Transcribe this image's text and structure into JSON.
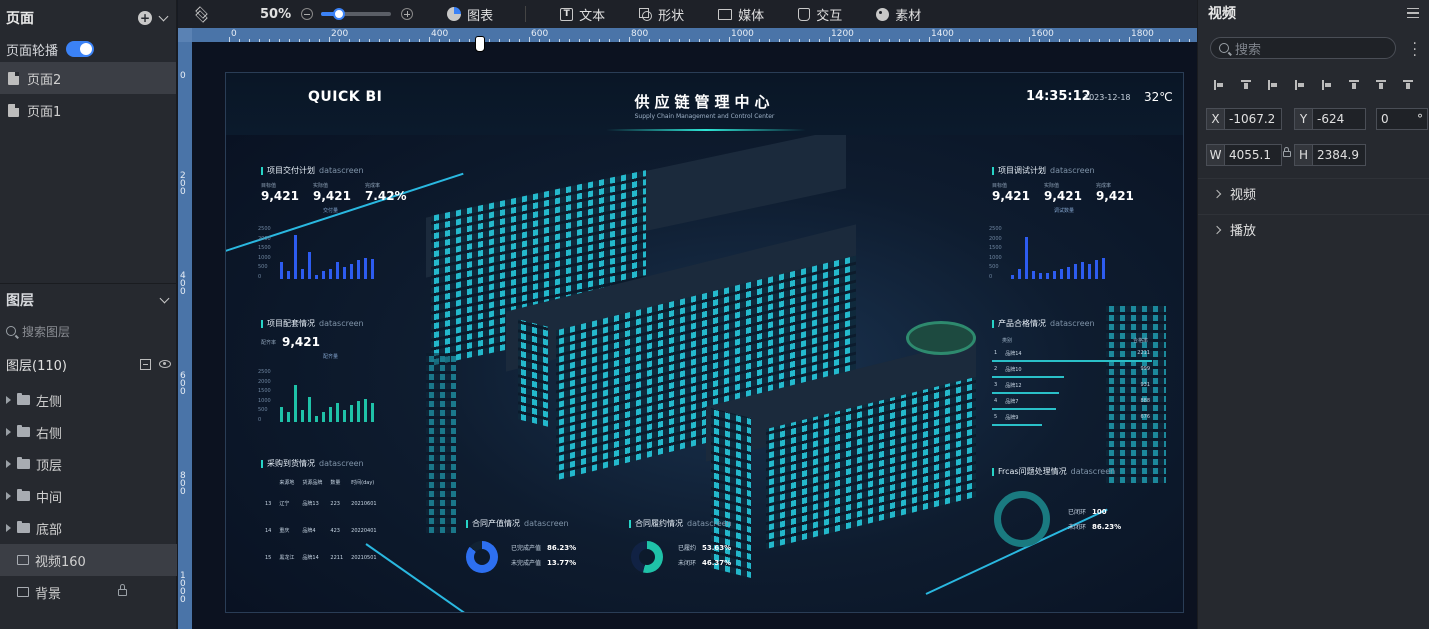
{
  "left_panel": {
    "pages_title": "页面",
    "carousel_label": "页面轮播",
    "pages": [
      {
        "label": "页面2",
        "selected": true
      },
      {
        "label": "页面1",
        "selected": false
      }
    ],
    "layers_title": "图层",
    "search_placeholder": "搜索图层",
    "layer_count_label": "图层(110)",
    "layers": [
      {
        "label": "左侧",
        "type": "folder"
      },
      {
        "label": "右侧",
        "type": "folder"
      },
      {
        "label": "顶层",
        "type": "folder"
      },
      {
        "label": "中间",
        "type": "folder"
      },
      {
        "label": "底部",
        "type": "folder"
      },
      {
        "label": "视频160",
        "type": "image",
        "selected": true
      },
      {
        "label": "背景",
        "type": "image",
        "locked": true
      }
    ]
  },
  "toolbar": {
    "zoom": "50%",
    "zoom_fraction": 0.25,
    "items": [
      {
        "label": "图表",
        "icon": "chart-icon"
      },
      {
        "label": "文本",
        "icon": "text-icon"
      },
      {
        "label": "形状",
        "icon": "shape-icon"
      },
      {
        "label": "媒体",
        "icon": "media-icon"
      },
      {
        "label": "交互",
        "icon": "interaction-icon"
      },
      {
        "label": "素材",
        "icon": "material-icon"
      }
    ]
  },
  "rulers": {
    "top": [
      "0",
      "200",
      "400",
      "600",
      "800",
      "1000",
      "1200",
      "1400",
      "1600",
      "1800"
    ],
    "left": [
      "0",
      "200",
      "400",
      "600",
      "800",
      "1000"
    ]
  },
  "dashboard": {
    "brand": "QUICK BI",
    "title": "供应链管理中心",
    "subtitle": "Supply Chain Management and Control Center",
    "time": "14:35:12",
    "date": "2023-12-18",
    "temperature": "32℃",
    "delivery": {
      "title": "项目交付计划",
      "tag": "datascreen",
      "kpis": [
        {
          "label": "目标值",
          "value": "9,421"
        },
        {
          "label": "实际值",
          "value": "9,421"
        },
        {
          "label": "完成率",
          "value": "7.42%"
        }
      ],
      "legend": "交付量",
      "axis": [
        "2500",
        "2000",
        "1500",
        "1000",
        "500",
        "0"
      ],
      "bars": [
        800,
        400,
        2100,
        500,
        1300,
        200,
        400,
        500,
        800,
        600,
        700,
        900,
        1000,
        950
      ]
    },
    "supply": {
      "title": "项目配套情况",
      "tag": "datascreen",
      "kpi_label": "配齐率",
      "kpi_value": "9,421",
      "legend": "配齐量",
      "axis": [
        "2500",
        "2000",
        "1500",
        "1000",
        "500",
        "0"
      ],
      "bars": [
        700,
        500,
        1800,
        600,
        1200,
        300,
        500,
        700,
        900,
        600,
        800,
        1000,
        1100,
        900
      ]
    },
    "purchase": {
      "title": "采购到货情况",
      "tag": "datascreen",
      "headers": [
        "来源地",
        "货源品牌",
        "数量",
        "时间(day)"
      ],
      "rows": [
        [
          "13",
          "辽宁",
          "品牌13",
          "223",
          "20210601"
        ],
        [
          "14",
          "重庆",
          "品牌4",
          "423",
          "20220401"
        ],
        [
          "15",
          "黑龙江",
          "品牌14",
          "2211",
          "20210501"
        ]
      ]
    },
    "contract_value": {
      "title": "合同产值情况",
      "tag": "datascreen",
      "items": [
        {
          "label": "已完成产值",
          "value": "86.23%"
        },
        {
          "label": "未完成产值",
          "value": "13.77%"
        }
      ]
    },
    "contract_perf": {
      "title": "合同履约情况",
      "tag": "datascreen",
      "items": [
        {
          "label": "已履约",
          "value": "53.63%"
        },
        {
          "label": "未闭环",
          "value": "46.37%"
        }
      ]
    },
    "debug": {
      "title": "项目调试计划",
      "tag": "datascreen",
      "kpis": [
        {
          "label": "目标值",
          "value": "9,421"
        },
        {
          "label": "实际值",
          "value": "9,421"
        },
        {
          "label": "完成率",
          "value": "9,421"
        }
      ],
      "legend": "调试数量",
      "axis": [
        "2500",
        "2000",
        "1500",
        "1000",
        "500",
        "0"
      ],
      "bars": [
        200,
        500,
        2000,
        400,
        300,
        300,
        400,
        500,
        600,
        700,
        800,
        700,
        900,
        1000
      ]
    },
    "quality": {
      "title": "产品合格情况",
      "tag": "datascreen",
      "headers": [
        "类别",
        "合格率"
      ],
      "rows": [
        {
          "rank": "1",
          "name": "品牌14",
          "value": "2211",
          "pct": 1.0
        },
        {
          "rank": "2",
          "name": "品牌10",
          "value": "999",
          "pct": 0.45
        },
        {
          "rank": "3",
          "name": "品牌12",
          "value": "931",
          "pct": 0.42
        },
        {
          "rank": "4",
          "name": "品牌7",
          "value": "888",
          "pct": 0.4
        },
        {
          "rank": "5",
          "name": "品牌9",
          "value": "676",
          "pct": 0.31
        }
      ]
    },
    "issues": {
      "title": "Frcas问题处理情况",
      "tag": "datascreen",
      "items": [
        {
          "label": "已闭环",
          "value": "100"
        },
        {
          "label": "未闭环",
          "value": "86.23%"
        }
      ]
    }
  },
  "right_panel": {
    "title": "视频",
    "search_placeholder": "搜索",
    "fields": {
      "x": "-1067.2",
      "y": "-624",
      "rotation": "0",
      "degree": "°",
      "w": "4055.1",
      "h": "2384.9"
    },
    "labels": {
      "x": "X",
      "y": "Y",
      "w": "W",
      "h": "H"
    },
    "sections": [
      "视频",
      "播放"
    ]
  },
  "colors": {
    "accent": "#3b82f6",
    "teal": "#27d3c6",
    "bar_blue": "#2d5cf0"
  }
}
